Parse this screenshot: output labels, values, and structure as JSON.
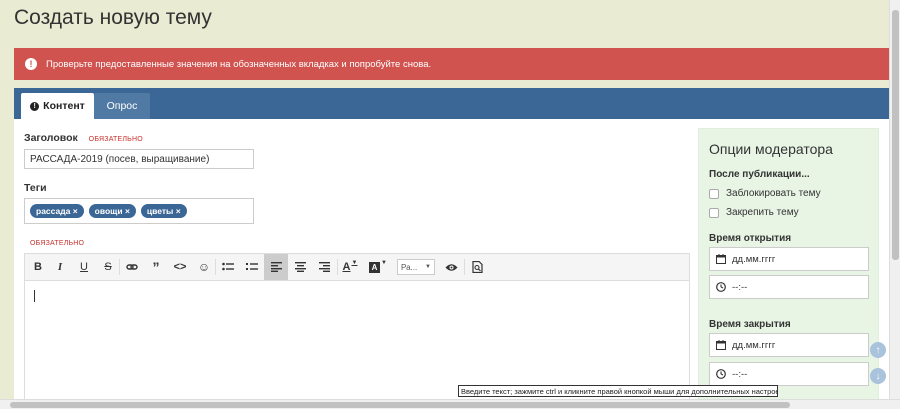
{
  "page": {
    "title": "Создать новую тему"
  },
  "alert": {
    "message": "Проверьте предоставленные значения на обозначенных вкладках и попробуйте снова."
  },
  "tabs": [
    {
      "label": "Контент",
      "active": true
    },
    {
      "label": "Опрос",
      "active": false
    }
  ],
  "form": {
    "title_label": "Заголовок",
    "required_text": "ОБЯЗАТЕЛЬНО",
    "title_value": "РАССАДА-2019 (посев, выращивание)",
    "tags_label": "Теги",
    "tags": [
      "рассада",
      "овощи",
      "цветы"
    ],
    "tag_remove": "×",
    "body_required_text": "ОБЯЗАТЕЛЬНО"
  },
  "editor": {
    "font_select_value": "Ра...",
    "toolbar": [
      "bold-icon",
      "italic-icon",
      "underline-icon",
      "strikethrough-icon",
      "link-icon",
      "quote-icon",
      "code-icon",
      "emoji-icon",
      "bullet-list-icon",
      "numbered-list-icon",
      "align-left-icon",
      "align-center-icon",
      "align-right-icon",
      "text-color-icon",
      "background-color-icon",
      "font-select",
      "preview-icon",
      "source-icon"
    ]
  },
  "moderator": {
    "title": "Опции модератора",
    "after_publish_label": "После публикации...",
    "lock_label": "Заблокировать тему",
    "pin_label": "Закрепить тему",
    "open_time_label": "Время открытия",
    "close_time_label": "Время закрытия",
    "date_placeholder": "дд.мм.гггг",
    "time_placeholder": "--:--"
  },
  "tooltip": {
    "text": "Введите текст; зажмите ctrl и кликните правой кнопкой мыши для дополнительных настроек."
  },
  "colors": {
    "accent": "#3b6796",
    "alert": "#d0534f",
    "sidebar": "#e8f5e5",
    "background": "#e9ebd3"
  }
}
